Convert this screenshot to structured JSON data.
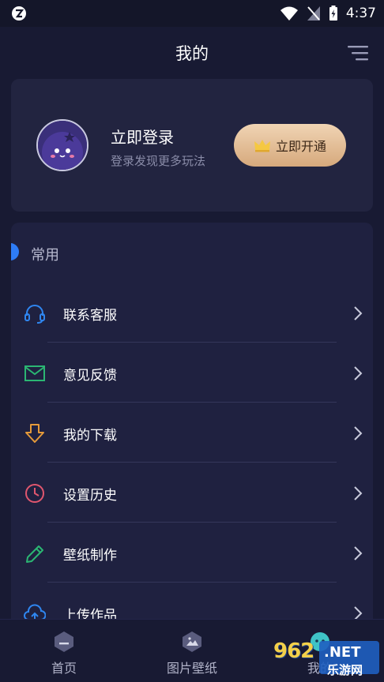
{
  "status_bar": {
    "time": "4:37"
  },
  "header": {
    "title": "我的"
  },
  "profile": {
    "login_title": "立即登录",
    "login_subtitle": "登录发现更多玩法",
    "vip_label": "立即开通"
  },
  "common": {
    "title": "常用",
    "items": [
      {
        "label": "联系客服",
        "icon": "headset-icon",
        "color": "#2f86f0"
      },
      {
        "label": "意见反馈",
        "icon": "mail-icon",
        "color": "#2bb673"
      },
      {
        "label": "我的下载",
        "icon": "download-icon",
        "color": "#e59a3a"
      },
      {
        "label": "设置历史",
        "icon": "clock-icon",
        "color": "#e0566e"
      },
      {
        "label": "壁纸制作",
        "icon": "pencil-icon",
        "color": "#2bb673"
      },
      {
        "label": "上传作品",
        "icon": "upload-cloud-icon",
        "color": "#2f86f0"
      }
    ]
  },
  "bottom_nav": {
    "items": [
      {
        "label": "首页"
      },
      {
        "label": "图片壁纸"
      },
      {
        "label": "我的"
      }
    ]
  },
  "watermark": {
    "number": "962",
    "suffix": ".NET",
    "site": "乐游网"
  },
  "colors": {
    "background": "#181a33",
    "card": "#222440",
    "accent_blue": "#2e7cf6",
    "vip_gold": "#e2bc92"
  }
}
